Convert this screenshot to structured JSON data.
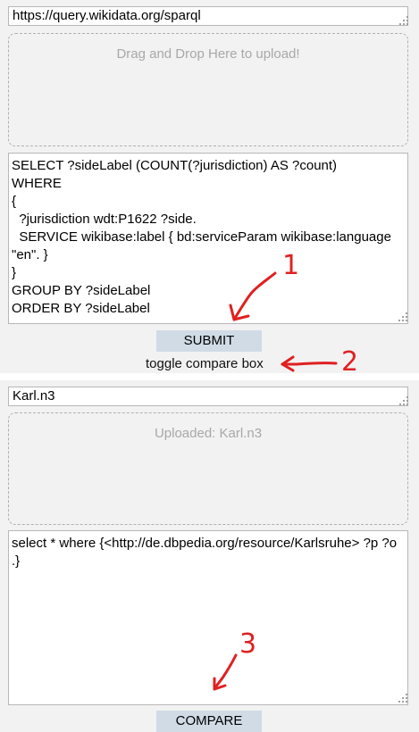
{
  "endpoint": {
    "url": "https://query.wikidata.org/sparql"
  },
  "upload_zone_1": {
    "text": "Drag and Drop Here to upload!"
  },
  "query_1": {
    "text": "SELECT ?sideLabel (COUNT(?jurisdiction) AS ?count)\nWHERE\n{\n  ?jurisdiction wdt:P1622 ?side.\n  SERVICE wikibase:label { bd:serviceParam wikibase:language \"en\". }\n}\nGROUP BY ?sideLabel\nORDER BY ?sideLabel"
  },
  "submit_label": "SUBMIT",
  "toggle_label": "toggle compare box",
  "compare": {
    "file_name": "Karl.n3",
    "upload_text": "Uploaded: Karl.n3",
    "query_text": "select * where {<http://de.dbpedia.org/resource/Karlsruhe> ?p ?o .}",
    "button_label": "COMPARE"
  },
  "annotations": [
    "1",
    "2",
    "3"
  ],
  "colors": {
    "annotation": "#e02020",
    "button_bg": "#d0dbe6"
  }
}
